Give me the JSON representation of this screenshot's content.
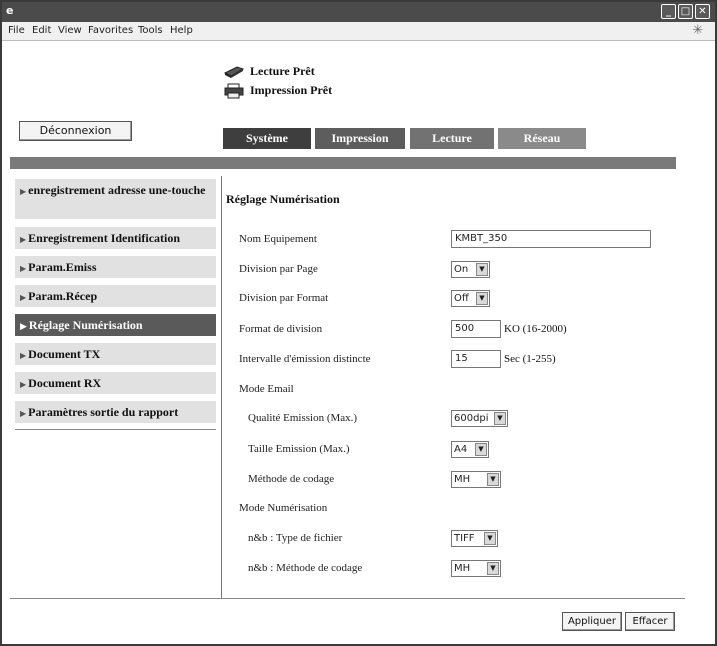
{
  "menu": [
    "File",
    "Edit",
    "View",
    "Favorites",
    "Tools",
    "Help"
  ],
  "status": {
    "scan": "Lecture Prêt",
    "print": "Impression Prêt"
  },
  "logout_label": "Déconnexion",
  "tabs": [
    "Système",
    "Impression",
    "Lecture",
    "Réseau"
  ],
  "sidebar": {
    "items": [
      "enregistrement adresse une-touche",
      "Enregistrement Identification",
      "Param.Emiss",
      "Param.Récep",
      "Réglage Numérisation",
      "Document TX",
      "Document RX",
      "Paramètres sortie du rapport"
    ],
    "active_index": 4
  },
  "form": {
    "title": "Réglage Numérisation",
    "device_name_label": "Nom Equipement",
    "device_name_value": "KMBT_350",
    "split_page_label": "Division par Page",
    "split_page_value": "On",
    "split_format_label": "Division par Format",
    "split_format_value": "Off",
    "split_format_size_label": "Format de division",
    "split_format_size_value": "500",
    "split_format_size_unit": "KO (16-2000)",
    "interval_label": "Intervalle d'émission distincte",
    "interval_value": "15",
    "interval_unit": "Sec (1-255)",
    "email_mode_label": "Mode Email",
    "email_quality_label": "Qualité Emission (Max.)",
    "email_quality_value": "600dpi",
    "email_size_label": "Taille Emission (Max.)",
    "email_size_value": "A4",
    "email_coding_label": "Méthode de codage",
    "email_coding_value": "MH",
    "scan_mode_label": "Mode Numérisation",
    "bw_filetype_label": "n&b : Type de fichier",
    "bw_filetype_value": "TIFF",
    "bw_coding_label": "n&b : Méthode de codage",
    "bw_coding_value": "MH"
  },
  "buttons": {
    "apply": "Appliquer",
    "clear": "Effacer"
  },
  "icons": {
    "app": "browser-app-icon",
    "scanner": "scanner-icon",
    "printer": "printer-icon",
    "sidebar_arrow": "triangle-right-icon",
    "select_arrow": "chevron-down-icon"
  },
  "colors": {
    "titlebar": "#4b4b4b",
    "active_tab": "#3e3e3e",
    "divider": "#7a7a7a",
    "sidebar_item": "#e1e1e1",
    "sidebar_active": "#5a5a5a"
  }
}
